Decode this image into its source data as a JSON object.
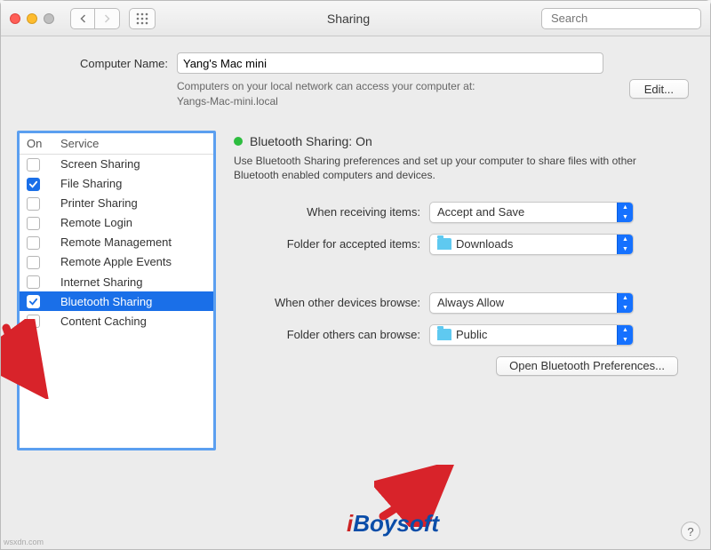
{
  "titlebar": {
    "title": "Sharing",
    "search_placeholder": "Search"
  },
  "computer": {
    "label": "Computer Name:",
    "value": "Yang's Mac mini",
    "info1": "Computers on your local network can access your computer at:",
    "info2": "Yangs-Mac-mini.local",
    "edit_label": "Edit..."
  },
  "services": {
    "col_on": "On",
    "col_service": "Service",
    "items": [
      {
        "label": "Screen Sharing",
        "checked": false,
        "selected": false
      },
      {
        "label": "File Sharing",
        "checked": true,
        "selected": false
      },
      {
        "label": "Printer Sharing",
        "checked": false,
        "selected": false
      },
      {
        "label": "Remote Login",
        "checked": false,
        "selected": false
      },
      {
        "label": "Remote Management",
        "checked": false,
        "selected": false
      },
      {
        "label": "Remote Apple Events",
        "checked": false,
        "selected": false
      },
      {
        "label": "Internet Sharing",
        "checked": false,
        "selected": false
      },
      {
        "label": "Bluetooth Sharing",
        "checked": true,
        "selected": true
      },
      {
        "label": "Content Caching",
        "checked": false,
        "selected": false
      }
    ]
  },
  "detail": {
    "status_label": "Bluetooth Sharing: On",
    "description": "Use Bluetooth Sharing preferences and set up your computer to share files with other Bluetooth enabled computers and devices.",
    "opts": {
      "receive_label": "When receiving items:",
      "receive_value": "Accept and Save",
      "accept_folder_label": "Folder for accepted items:",
      "accept_folder_value": "Downloads",
      "browse_label": "When other devices browse:",
      "browse_value": "Always Allow",
      "browse_folder_label": "Folder others can browse:",
      "browse_folder_value": "Public"
    },
    "open_prefs_label": "Open Bluetooth Preferences..."
  },
  "logo": {
    "i": "i",
    "rest": "Boysoft"
  },
  "watermark": "wsxdn.com"
}
